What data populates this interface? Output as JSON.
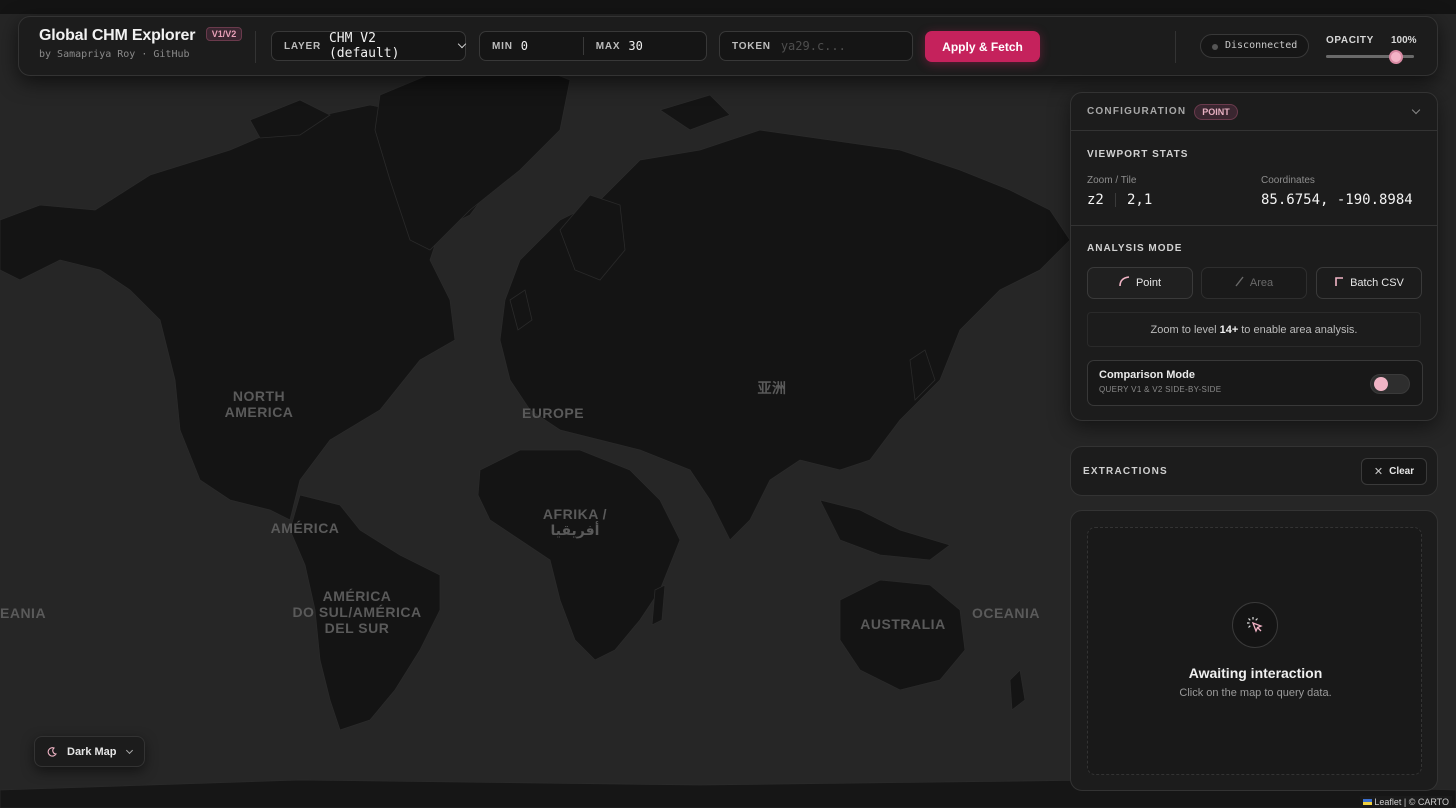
{
  "app": {
    "title": "Global CHM Explorer",
    "version_badge": "V1/V2",
    "subtitle": "by Samapriya Roy · GitHub"
  },
  "toolbar": {
    "layer_label": "LAYER",
    "layer_value": "CHM V2 (default)",
    "min_label": "MIN",
    "min_value": "0",
    "max_label": "MAX",
    "max_value": "30",
    "token_label": "TOKEN",
    "token_placeholder": "ya29.c...",
    "apply_label": "Apply & Fetch",
    "status": "Disconnected",
    "opacity_label": "OPACITY",
    "opacity_value": "100%",
    "opacity_fraction": 1.0
  },
  "config": {
    "title": "CONFIGURATION",
    "badge": "POINT",
    "viewport_title": "VIEWPORT STATS",
    "zoom_tile_label": "Zoom / Tile",
    "zoom": "z2",
    "tile": "2,1",
    "coords_label": "Coordinates",
    "coords": "85.6754, -190.8984",
    "analysis_title": "ANALYSIS MODE",
    "modes": [
      "Point",
      "Area",
      "Batch CSV"
    ],
    "hint_prefix": "Zoom to level",
    "hint_level": "14+",
    "hint_suffix": "to enable area analysis.",
    "comparison_title": "Comparison Mode",
    "comparison_sub": "QUERY V1 & V2 SIDE-BY-SIDE",
    "comparison_on": false
  },
  "extractions": {
    "title": "EXTRACTIONS",
    "clear_label": "Clear",
    "empty_title": "Awaiting interaction",
    "empty_sub": "Click on the map to query data."
  },
  "map": {
    "base_style": "Dark Map",
    "labels": {
      "north_america": "NORTH\nAMERICA",
      "america": "AMÉRICA",
      "south_america": "AMÉRICA\nDO SUL/AMÉRICA\nDEL SUR",
      "europe": "EUROPE",
      "africa": "AFRIKA /\nأفريقيا",
      "asia": "亚洲",
      "australia": "AUSTRALIA",
      "oceania_right": "OCEANIA",
      "oceania_left": "EANIA"
    },
    "attribution": "Leaflet | © CARTO"
  },
  "colors": {
    "accent": "#c5225c",
    "land": "#151515",
    "ocean": "#262626"
  }
}
